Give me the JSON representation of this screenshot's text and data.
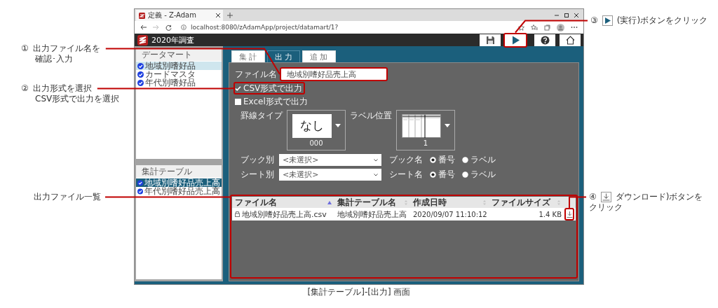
{
  "browser": {
    "tab_title": "定義 - Z-Adam",
    "url": "localhost:8080/zAdamApp/project/datamart/1?"
  },
  "app": {
    "title": "2020年調査",
    "toolbar": [
      {
        "kind": "save"
      },
      {
        "kind": "run"
      },
      {
        "kind": "help"
      },
      {
        "kind": "home"
      }
    ]
  },
  "sidebar": [
    {
      "title": "データマート",
      "items": [
        {
          "label": "地域別嗜好品",
          "selected": true
        },
        {
          "label": "カードマスタ",
          "selected": false
        },
        {
          "label": "年代別嗜好品",
          "selected": false
        }
      ]
    },
    {
      "title": "集計テーブル",
      "items": [
        {
          "label": "地域別嗜好品売上高",
          "selected": true
        },
        {
          "label": "年代別嗜好品売上高",
          "selected": false
        }
      ]
    }
  ],
  "tabs": [
    {
      "label": "集 計",
      "selected": false
    },
    {
      "label": "出 力",
      "selected": true
    },
    {
      "label": "追 加",
      "selected": false
    }
  ],
  "form": {
    "file_name": {
      "label": "ファイル名",
      "value": "地域別嗜好品売上高"
    },
    "formats": [
      {
        "label": "CSV形式で出力",
        "checked": true
      },
      {
        "label": "Excel形式で出力",
        "checked": false
      }
    ],
    "pickers": [
      {
        "label": "罫線タイプ",
        "kind": "text",
        "preview": "なし",
        "value": "000"
      },
      {
        "label": "ラベル位置",
        "kind": "grid",
        "value": "1"
      }
    ],
    "splits": [
      {
        "label": "ブック別",
        "value": "<未選択>",
        "name_label": "ブック名",
        "options": [
          {
            "label": "番号",
            "selected": true
          },
          {
            "label": "ラベル",
            "selected": false
          }
        ]
      },
      {
        "label": "シート別",
        "value": "<未選択>",
        "name_label": "シート名",
        "options": [
          {
            "label": "番号",
            "selected": true
          },
          {
            "label": "ラベル",
            "selected": false
          }
        ]
      }
    ]
  },
  "file_table": {
    "columns": [
      {
        "label": "ファイル名",
        "sorted": true
      },
      {
        "label": "集計テーブル名",
        "sorted": false
      },
      {
        "label": "作成日時",
        "sorted": false
      },
      {
        "label": "ファイルサイズ",
        "sorted": false
      }
    ],
    "rows": [
      {
        "cells": [
          "地域別嗜好品売上高.csv",
          "地域別嗜好品売上高",
          "2020/09/07 11:10:12",
          "1.4 KB"
        ]
      }
    ]
  },
  "annotations": [
    {
      "kind": "plain",
      "number": "①",
      "lines": [
        "出力ファイル名を",
        "確認･入力"
      ]
    },
    {
      "kind": "plain",
      "number": "②",
      "lines": [
        "出力形式を選択",
        "CSV形式で出力を選択"
      ]
    },
    {
      "kind": "play",
      "number": "③",
      "lines": [
        "(実行)ボタンをクリック"
      ]
    },
    {
      "kind": "plain",
      "lines": [
        "出力ファイル一覧"
      ]
    },
    {
      "kind": "download",
      "number": "④",
      "lines": [
        "ダウンロード)ボタンを",
        "クリック"
      ]
    }
  ],
  "caption": "[集計テーブル]-[出力] 画面"
}
